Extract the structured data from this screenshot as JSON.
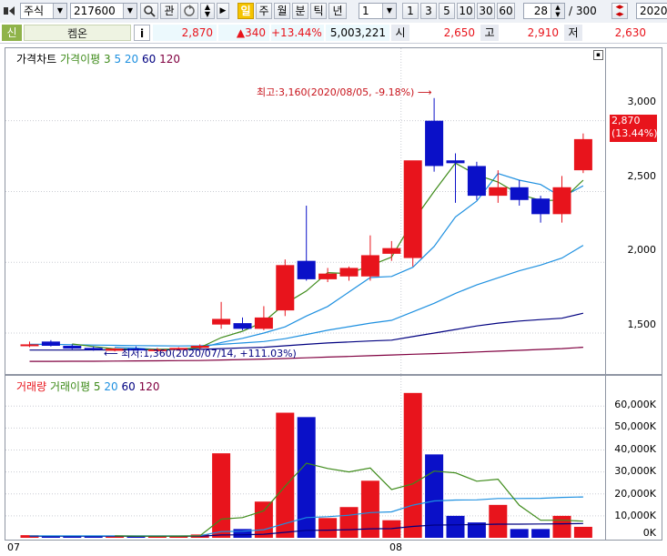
{
  "toolbar": {
    "market": "주식",
    "code": "217600",
    "btn_gwan": "관",
    "period_active": "일",
    "periods": [
      "주",
      "월",
      "분",
      "틱",
      "년"
    ],
    "unit_value": "1",
    "quick_units": [
      "1",
      "3",
      "5",
      "10",
      "30",
      "60"
    ],
    "count_value": "28",
    "count_total": "/ 300",
    "date_value": "2020/"
  },
  "quote": {
    "tag": "신",
    "name": "켐온",
    "info": "i",
    "price": "2,870",
    "change": "▲340",
    "rate": "+13.44%",
    "volume": "5,003,221",
    "open_label": "시",
    "open": "2,650",
    "high_label": "고",
    "high": "2,910",
    "low_label": "저",
    "low": "2,630"
  },
  "colors": {
    "up": "#e8141c",
    "down": "#0a10c8",
    "ma5": "#3e8b1a",
    "ma20": "#1e90e0",
    "ma60": "#000080",
    "ma120": "#800040"
  },
  "chart_data": [
    {
      "type": "candlestick",
      "legend": [
        "가격차트",
        "가격이평 3",
        "5",
        "20",
        "60",
        "120"
      ],
      "y_ticks": [
        "3,000",
        "2,500",
        "2,000",
        "1,500"
      ],
      "ylim": [
        1230,
        3300
      ],
      "x_tick_labels": [
        "07",
        "08"
      ],
      "annotations": {
        "high": "최고:3,160(2020/08/05, -9.18%)",
        "low": "최저:1,360(2020/07/14, +111.03%)"
      },
      "current_price_label": "2,870",
      "current_rate_label": "(13.44%)",
      "candles": [
        {
          "o": 1420,
          "h": 1440,
          "l": 1400,
          "c": 1420
        },
        {
          "o": 1440,
          "h": 1450,
          "l": 1405,
          "c": 1410
        },
        {
          "o": 1410,
          "h": 1420,
          "l": 1385,
          "c": 1390
        },
        {
          "o": 1395,
          "h": 1405,
          "l": 1375,
          "c": 1385
        },
        {
          "o": 1375,
          "h": 1395,
          "l": 1370,
          "c": 1390
        },
        {
          "o": 1390,
          "h": 1405,
          "l": 1375,
          "c": 1380
        },
        {
          "o": 1380,
          "h": 1395,
          "l": 1370,
          "c": 1385
        },
        {
          "o": 1385,
          "h": 1400,
          "l": 1375,
          "c": 1395
        },
        {
          "o": 1395,
          "h": 1420,
          "l": 1385,
          "c": 1410
        },
        {
          "o": 1560,
          "h": 1720,
          "l": 1530,
          "c": 1600
        },
        {
          "o": 1570,
          "h": 1610,
          "l": 1520,
          "c": 1530
        },
        {
          "o": 1530,
          "h": 1690,
          "l": 1520,
          "c": 1610
        },
        {
          "o": 1660,
          "h": 2020,
          "l": 1620,
          "c": 1980
        },
        {
          "o": 2010,
          "h": 2400,
          "l": 1870,
          "c": 1880
        },
        {
          "o": 1880,
          "h": 1960,
          "l": 1860,
          "c": 1920
        },
        {
          "o": 1900,
          "h": 1970,
          "l": 1870,
          "c": 1960
        },
        {
          "o": 1900,
          "h": 2190,
          "l": 1870,
          "c": 2050
        },
        {
          "o": 2060,
          "h": 2150,
          "l": 2010,
          "c": 2100
        },
        {
          "o": 2030,
          "h": 2420,
          "l": 1970,
          "c": 2720
        },
        {
          "o": 3000,
          "h": 3160,
          "l": 2640,
          "c": 2680
        },
        {
          "o": 2720,
          "h": 2770,
          "l": 2420,
          "c": 2700
        },
        {
          "o": 2680,
          "h": 2710,
          "l": 2440,
          "c": 2470
        },
        {
          "o": 2470,
          "h": 2650,
          "l": 2420,
          "c": 2530
        },
        {
          "o": 2530,
          "h": 2580,
          "l": 2400,
          "c": 2440
        },
        {
          "o": 2450,
          "h": 2470,
          "l": 2280,
          "c": 2340
        },
        {
          "o": 2340,
          "h": 2610,
          "l": 2280,
          "c": 2530
        },
        {
          "o": 2650,
          "h": 2910,
          "l": 2630,
          "c": 2870
        }
      ],
      "ma3": [
        null,
        null,
        1423,
        1405,
        1388,
        1385,
        1385,
        1387,
        1397,
        1468,
        1513,
        1580,
        1707,
        1797,
        1927,
        1920,
        1977,
        2037,
        2290,
        2500,
        2700,
        2617,
        2567,
        2480,
        2437,
        2437,
        2580
      ],
      "ma5": [
        null,
        null,
        null,
        null,
        1399,
        1394,
        1384,
        1385,
        1394,
        1433,
        1463,
        1500,
        1544,
        1620,
        1688,
        1790,
        1892,
        1900,
        1965,
        2112,
        2320,
        2432,
        2627,
        2580,
        2550,
        2460,
        2540
      ],
      "ma20": [
        1420,
        1420,
        1418,
        1415,
        1413,
        1411,
        1410,
        1409,
        1410,
        1420,
        1430,
        1440,
        1460,
        1490,
        1520,
        1545,
        1570,
        1590,
        1650,
        1710,
        1780,
        1840,
        1890,
        1940,
        1980,
        2030,
        2120
      ],
      "ma60": [
        1380,
        1380,
        1380,
        1381,
        1381,
        1382,
        1382,
        1383,
        1384,
        1390,
        1395,
        1400,
        1410,
        1420,
        1430,
        1437,
        1444,
        1450,
        1475,
        1500,
        1525,
        1550,
        1570,
        1585,
        1595,
        1605,
        1640
      ],
      "ma120": [
        1300,
        1300,
        1301,
        1301,
        1302,
        1303,
        1304,
        1305,
        1306,
        1310,
        1313,
        1316,
        1320,
        1325,
        1330,
        1335,
        1340,
        1345,
        1350,
        1355,
        1360,
        1366,
        1372,
        1378,
        1384,
        1390,
        1400
      ]
    },
    {
      "type": "bar",
      "legend": [
        "거래량",
        "거래이평 5",
        "20",
        "60",
        "120"
      ],
      "y_ticks": [
        "60,000K",
        "50,000K",
        "40,000K",
        "30,000K",
        "20,000K",
        "10,000K",
        "0K"
      ],
      "ylim": [
        0,
        68000
      ],
      "x_tick_labels": [
        "07",
        "08"
      ],
      "volumes": [
        1200,
        800,
        700,
        900,
        600,
        700,
        800,
        900,
        1500,
        38500,
        4000,
        16500,
        57000,
        55000,
        9000,
        14000,
        26000,
        8000,
        66000,
        38000,
        10000,
        7000,
        15000,
        4000,
        4000,
        10000,
        5000
      ],
      "vma5": [
        null,
        null,
        null,
        null,
        850,
        740,
        740,
        780,
        900,
        8500,
        9200,
        12300,
        23500,
        34000,
        31600,
        30000,
        31800,
        22000,
        24600,
        30400,
        29600,
        25800,
        26700,
        14800,
        8000,
        8000,
        7600
      ],
      "vma20": [
        900,
        900,
        900,
        900,
        900,
        900,
        900,
        900,
        950,
        2800,
        3000,
        3700,
        6500,
        9200,
        9600,
        10300,
        11500,
        11800,
        14900,
        16800,
        17200,
        17300,
        17900,
        17900,
        18000,
        18400,
        18600
      ],
      "vma60": [
        700,
        700,
        700,
        700,
        700,
        700,
        700,
        700,
        720,
        1300,
        1350,
        1600,
        2500,
        3400,
        3500,
        3700,
        4100,
        4200,
        5200,
        5800,
        5900,
        6000,
        6200,
        6200,
        6300,
        6400,
        6500
      ]
    }
  ]
}
